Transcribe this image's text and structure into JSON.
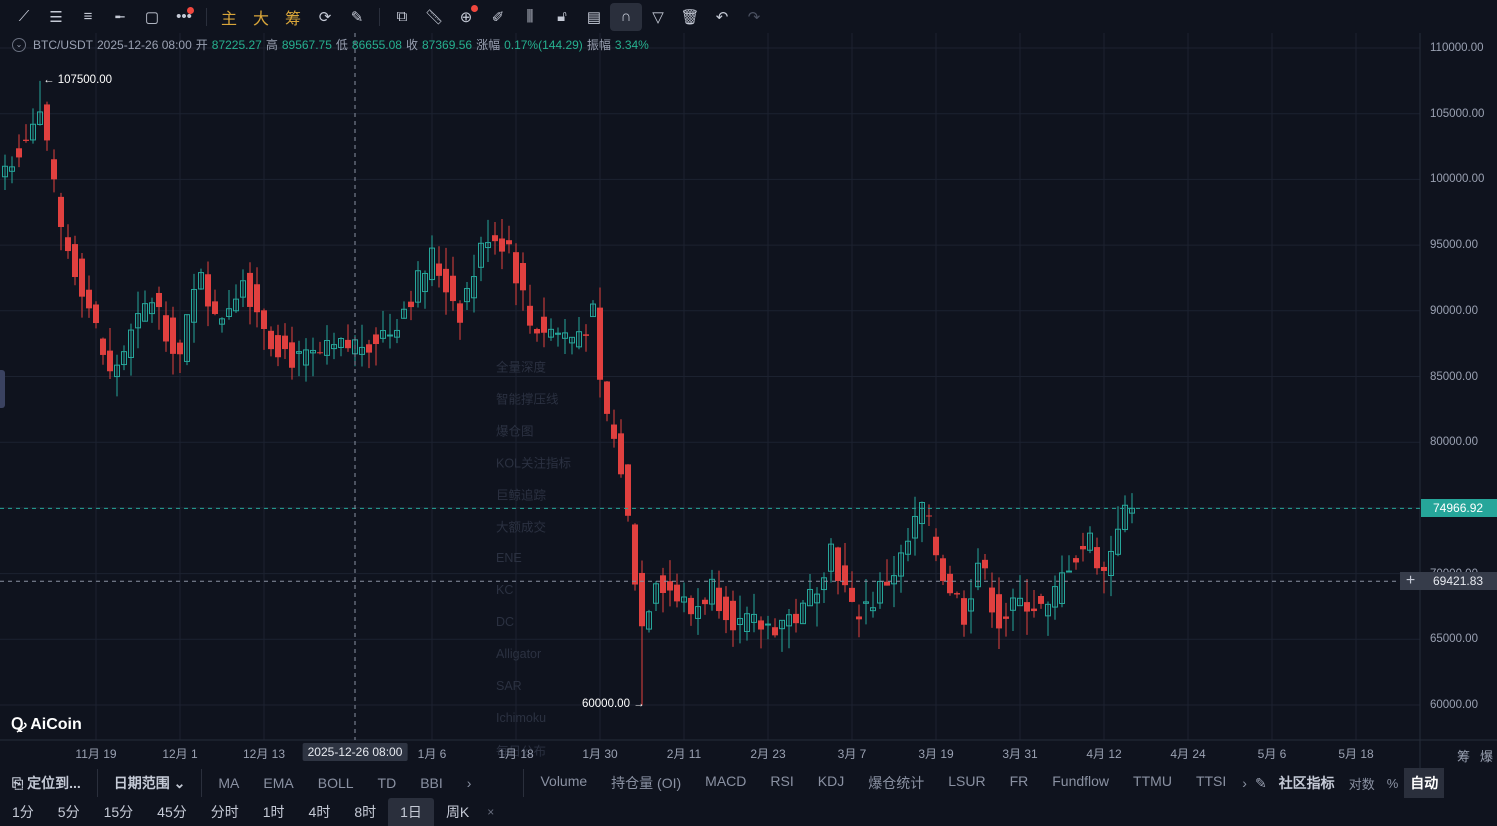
{
  "toolbar": {
    "tools": [
      "trend-line",
      "horizontal-lines",
      "parallel-lines",
      "horizontal-ray",
      "rectangle",
      "more-tools"
    ],
    "main_label": "主",
    "big_label": "大",
    "chips_label": "筹",
    "tools2": [
      "template",
      "eraser",
      "ruler",
      "zoom-alert",
      "brush",
      "measure",
      "lock",
      "notes",
      "magnet",
      "filter",
      "trash",
      "undo",
      "redo"
    ]
  },
  "info": {
    "symbol": "BTC/USDT",
    "datetime": "2025-12-26 08:00",
    "open_label": "开",
    "open": "87225.27",
    "high_label": "高",
    "high": "89567.75",
    "low_label": "低",
    "low": "86655.08",
    "close_label": "收",
    "close": "87369.56",
    "change_label": "涨幅",
    "change": "0.17%(144.29)",
    "amp_label": "振幅",
    "amp": "3.34%"
  },
  "overlay_menu": [
    "全量深度",
    "智能撑压线",
    "爆仓图",
    "KOL关注指标",
    "巨鲸追踪",
    "大额成交",
    "ENE",
    "KC",
    "DC",
    "Alligator",
    "SAR",
    "Ichimoku",
    "每日公布"
  ],
  "logo": "AiCoin",
  "chart_data": {
    "type": "candlestick",
    "symbol": "BTC/USDT",
    "interval": "1日",
    "ylim": [
      57000,
      111500
    ],
    "yticks": [
      "110000.00",
      "105000.00",
      "100000.00",
      "95000.00",
      "90000.00",
      "85000.00",
      "80000.00",
      "75000.00",
      "70000.00",
      "65000.00",
      "60000.00"
    ],
    "ytick_values": [
      110000,
      105000,
      100000,
      95000,
      90000,
      85000,
      80000,
      75000,
      70000,
      65000,
      60000
    ],
    "xticks": [
      {
        "day": 13,
        "label": "11月 19"
      },
      {
        "day": 25,
        "label": "12月 1"
      },
      {
        "day": 37,
        "label": "12月 13"
      },
      {
        "day": 61,
        "label": "1月 6"
      },
      {
        "day": 73,
        "label": "1月 18"
      },
      {
        "day": 85,
        "label": "1月 30"
      },
      {
        "day": 97,
        "label": "2月 11"
      },
      {
        "day": 109,
        "label": "2月 23"
      },
      {
        "day": 121,
        "label": "3月 7"
      },
      {
        "day": 133,
        "label": "3月 19"
      },
      {
        "day": 145,
        "label": "3月 31"
      },
      {
        "day": 157,
        "label": "4月 12"
      },
      {
        "day": 169,
        "label": "4月 24"
      },
      {
        "day": 181,
        "label": "5月 6"
      },
      {
        "day": 193,
        "label": "5月 18"
      }
    ],
    "close_anchors": [
      [
        0,
        101000
      ],
      [
        5,
        105000
      ],
      [
        8,
        96000
      ],
      [
        11,
        92000
      ],
      [
        15,
        85000
      ],
      [
        21,
        91000
      ],
      [
        25,
        86500
      ],
      [
        28,
        93500
      ],
      [
        30,
        89000
      ],
      [
        34,
        92500
      ],
      [
        38,
        88000
      ],
      [
        42,
        86000
      ],
      [
        50,
        87400
      ],
      [
        55,
        88500
      ],
      [
        61,
        94000
      ],
      [
        65,
        90000
      ],
      [
        69,
        96000
      ],
      [
        72,
        95000
      ],
      [
        75,
        89000
      ],
      [
        81,
        88000
      ],
      [
        84,
        89500
      ],
      [
        85,
        84000
      ],
      [
        88,
        78000
      ],
      [
        91,
        66000
      ],
      [
        93,
        70000
      ],
      [
        98,
        67000
      ],
      [
        101,
        69000
      ],
      [
        105,
        66000
      ],
      [
        109,
        66000
      ],
      [
        114,
        67000
      ],
      [
        118,
        72000
      ],
      [
        121,
        67000
      ],
      [
        124,
        68000
      ],
      [
        128,
        71000
      ],
      [
        131,
        75000
      ],
      [
        134,
        70000
      ],
      [
        137,
        67000
      ],
      [
        139,
        71000
      ],
      [
        142,
        66500
      ],
      [
        146,
        68000
      ],
      [
        149,
        67000
      ],
      [
        152,
        71000
      ],
      [
        155,
        72500
      ],
      [
        157,
        70000
      ],
      [
        159,
        74000
      ],
      [
        161,
        74967
      ]
    ],
    "max_marker": {
      "day": 5,
      "value": 107500,
      "label": "← 107500.00"
    },
    "min_marker": {
      "day": 91,
      "value": 60000,
      "label": "60000.00 →"
    },
    "crosshair": {
      "day": 50,
      "date_label": "2025-12-26 08:00",
      "price": 69421.83,
      "price_label": "69421.83"
    },
    "last_price": {
      "value": 74966.92,
      "label": "74966.92"
    },
    "colors": {
      "up": "#26a69a",
      "down": "#e0403f",
      "bg": "#0f131e",
      "grid": "#1c2230"
    }
  },
  "axis_right_labels": {
    "chips": "筹",
    "liq": "爆"
  },
  "bottom": {
    "locate": "定位到...",
    "date_range": "日期范围",
    "main_indicators": [
      "MA",
      "EMA",
      "BOLL",
      "TD",
      "BBI"
    ],
    "sub_indicators": [
      "Volume",
      "持仓量 (OI)",
      "MACD",
      "RSI",
      "KDJ",
      "爆仓统计",
      "LSUR",
      "FR",
      "Fundflow",
      "TTMU",
      "TTSI"
    ],
    "community": "社区指标",
    "log": "对数",
    "pct": "%",
    "auto": "自动",
    "intervals": [
      "1分",
      "5分",
      "15分",
      "45分",
      "分时",
      "1时",
      "4时",
      "8时",
      "1日",
      "周K"
    ],
    "close": "×"
  }
}
